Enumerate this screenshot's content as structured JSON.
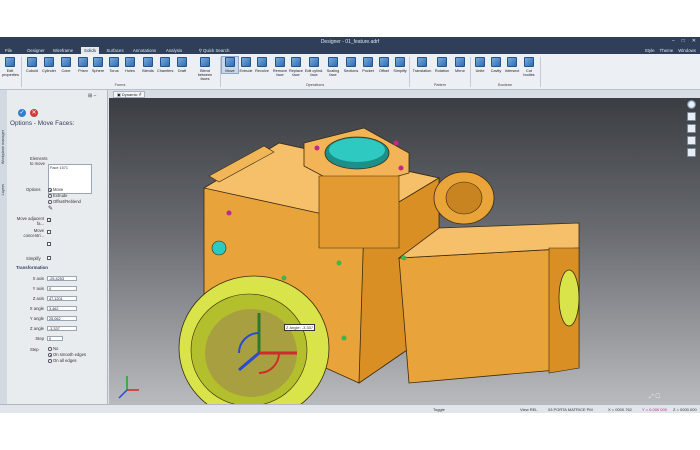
{
  "window": {
    "title": "Designer - 01_feature.adrf"
  },
  "menu": {
    "tabs": [
      "File",
      "Designer",
      "Wireframe",
      "Solids",
      "Surfaces",
      "Annotations",
      "Analysis",
      "Quick Search"
    ],
    "active_tab": "Solids",
    "right_items": [
      "Style",
      "Theme",
      "Windows"
    ]
  },
  "ribbon": {
    "buttons": [
      "Edit properties",
      "Cuboid",
      "Cylinder",
      "Cone",
      "Prism",
      "Sphere",
      "Torus",
      "Holes",
      "Blends",
      "Chamfers",
      "Draft",
      "Blend between faces",
      "Move",
      "Extrude",
      "Revolve",
      "Remove face",
      "Replace face",
      "Edit cylind. face",
      "Scaling face",
      "Sections",
      "Pocket",
      "Offset",
      "Simplify",
      "Translation",
      "Rotation",
      "Mirror",
      "Unite",
      "Cavity",
      "Intersect",
      "Cut bodies"
    ],
    "selected": "Move",
    "groups": [
      "Forms",
      "Operations",
      "Pattern",
      "Boolean"
    ]
  },
  "panel": {
    "side_tabs": [
      "Workplane manager",
      "Layers"
    ],
    "title": "Options - Move Faces:",
    "elements_label": "Elements to move",
    "elements_value": "Face 1571",
    "options_label": "Options",
    "options": [
      "Move",
      "Extrude",
      "Offset/Reblend"
    ],
    "options_selected": "Move",
    "move_adjacent_label": "Move adjacent fa...",
    "move_concentric_label": "Move concentri...",
    "simplify_label": "Simplify",
    "transformation_label": "Transformation",
    "fields": [
      {
        "label": "X axis",
        "value": "-25,4253"
      },
      {
        "label": "Y axis",
        "value": "0"
      },
      {
        "label": "Z axis",
        "value": "47,1201"
      },
      {
        "label": "X angle",
        "value": "3,462"
      },
      {
        "label": "Y angle",
        "value": "25,062"
      },
      {
        "label": "Z angle",
        "value": "-3,337"
      },
      {
        "label": "Step",
        "value": "0"
      }
    ],
    "step_label": "Step",
    "step_options": [
      "No",
      "On smooth edges",
      "On all edges"
    ],
    "step_selected": "On smooth edges",
    "automatic_label": "Automatic",
    "preview_label": "Preview"
  },
  "viewport": {
    "tab_label": "Dynamic",
    "angle_tooltip": "Z Angle: -3.337"
  },
  "statusbar": {
    "toggle": "Toggle",
    "view": "View REL",
    "position": "03 PORTA MATRICE PM",
    "x": "X = 0000.762",
    "y": "Y = 0.000 000",
    "z": "Z = 0000.000"
  },
  "colors": {
    "part": "#e8a33a",
    "bore": "#2ec9c0",
    "handle": "#d9e34a",
    "hole_green": "#3fb54a",
    "hole_magenta": "#c0288a",
    "accent": "#2f3f59"
  }
}
